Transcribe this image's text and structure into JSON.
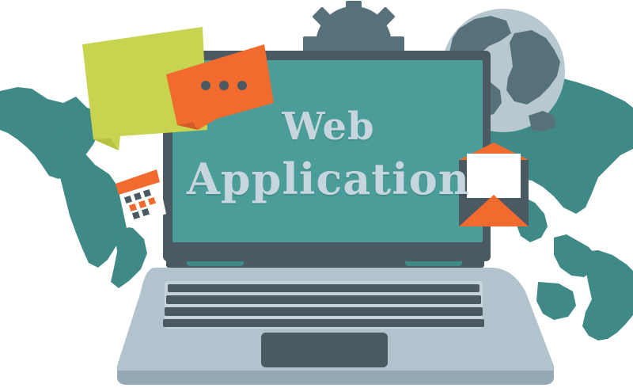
{
  "screen_title": {
    "line1": "Web",
    "line2": "Application"
  },
  "colors": {
    "map": "#3f8a86",
    "laptop_body": "#a9bcc7",
    "laptop_dark": "#4b5963",
    "screen_teal": "#4b9d99",
    "screen_text": "#c7d6de",
    "accent_orange": "#f16b2f",
    "bubble_yellow": "#c7d44f"
  },
  "icons": [
    "world-map-background",
    "globe-icon",
    "gear-icon",
    "chat-bubble-icon",
    "chat-bubble-dots-icon",
    "calendar-icon",
    "envelope-icon",
    "laptop-icon"
  ]
}
